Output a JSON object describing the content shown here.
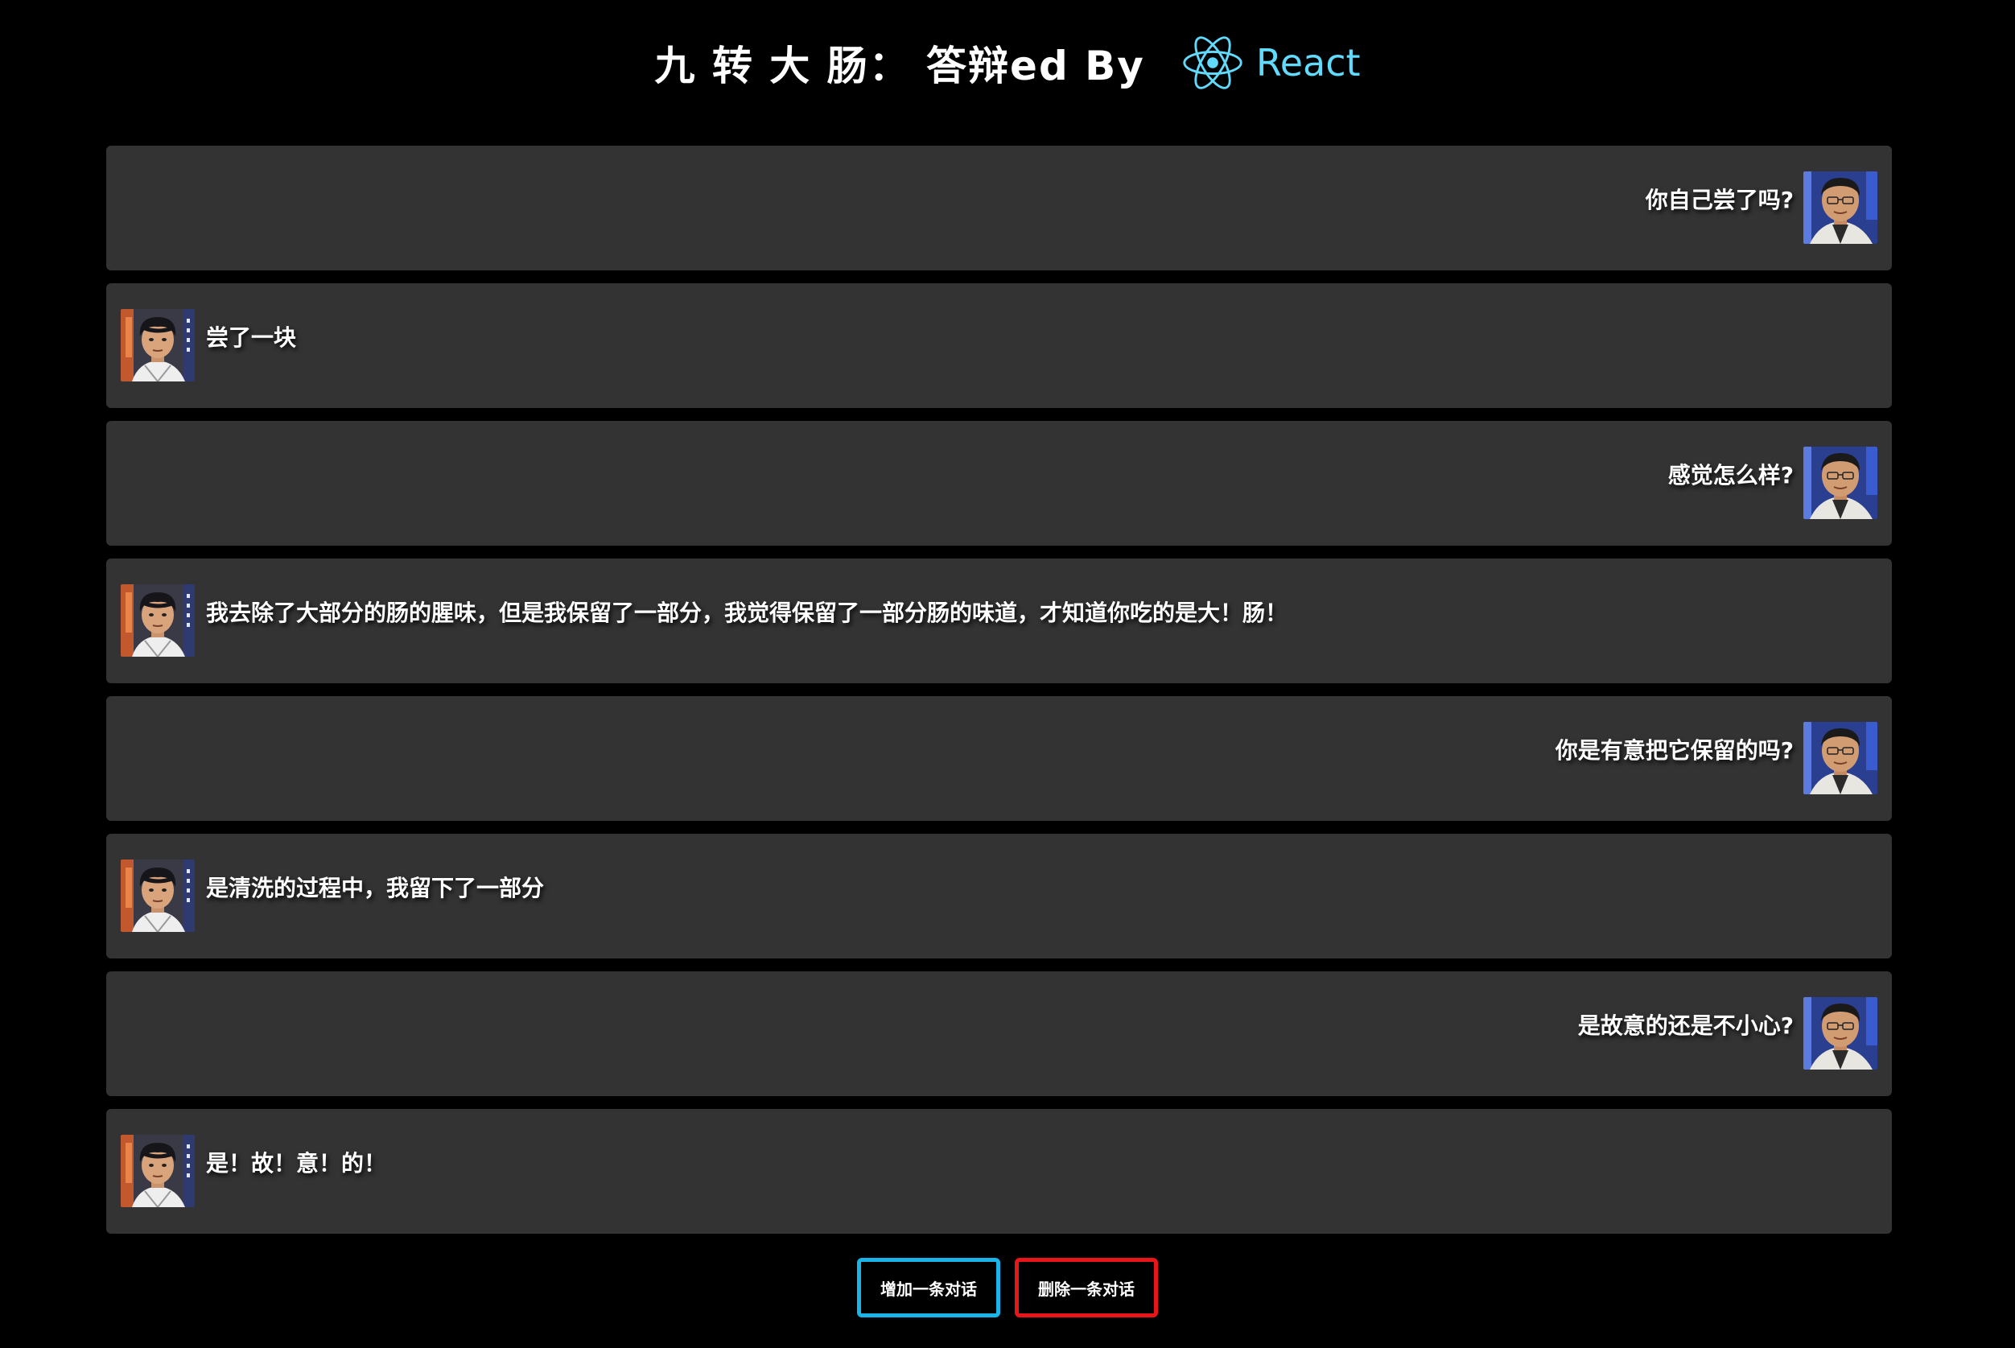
{
  "header": {
    "title": "九 转 大 肠： 答辩ed By",
    "framework_label": "React",
    "framework_color": "#61dafb"
  },
  "messages": [
    {
      "side": "right",
      "speaker": "judge",
      "text": "你自己尝了吗?"
    },
    {
      "side": "left",
      "speaker": "chef",
      "text": "尝了一块"
    },
    {
      "side": "right",
      "speaker": "judge",
      "text": "感觉怎么样?"
    },
    {
      "side": "left",
      "speaker": "chef",
      "text": "我去除了大部分的肠的腥味，但是我保留了一部分，我觉得保留了一部分肠的味道，才知道你吃的是大！肠！"
    },
    {
      "side": "right",
      "speaker": "judge",
      "text": "你是有意把它保留的吗?"
    },
    {
      "side": "left",
      "speaker": "chef",
      "text": "是清洗的过程中，我留下了一部分"
    },
    {
      "side": "right",
      "speaker": "judge",
      "text": "是故意的还是不小心?"
    },
    {
      "side": "left",
      "speaker": "chef",
      "text": "是！故！意！的！"
    }
  ],
  "buttons": {
    "add_label": "增加一条对话",
    "add_color": "#1ab4e8",
    "delete_label": "删除一条对话",
    "delete_color": "#e8151b"
  },
  "colors": {
    "background": "#000000",
    "card": "#333333"
  }
}
